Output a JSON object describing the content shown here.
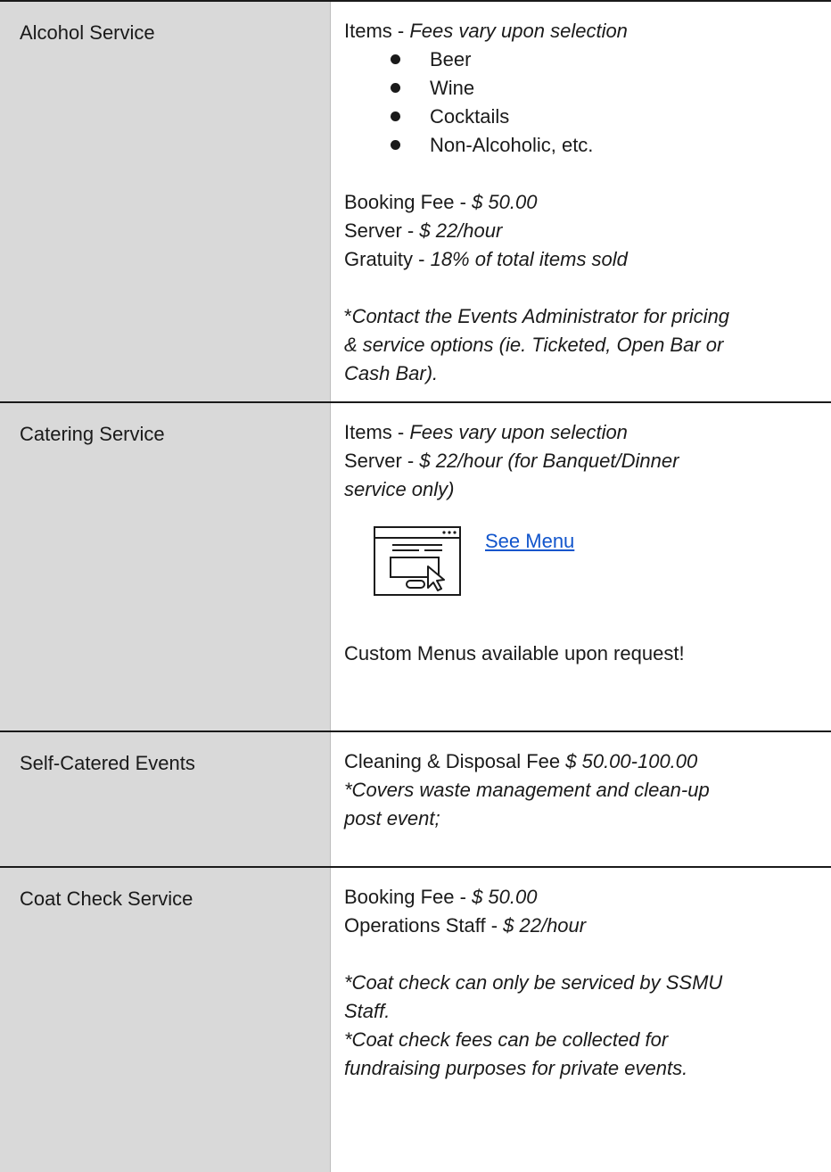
{
  "rows": [
    {
      "label": "Alcohol Service",
      "items_label": "Items - ",
      "items_value": "Fees vary upon selection",
      "bullets": [
        "Beer",
        "Wine",
        "Cocktails",
        "Non-Alcoholic, etc."
      ],
      "fees": [
        {
          "label": "Booking Fee - ",
          "value": "$ 50.00"
        },
        {
          "label": "Server - ",
          "value": "$ 22/hour"
        },
        {
          "label": "Gratuity - ",
          "value": "18% of total items sold"
        }
      ],
      "note_prefix": "*",
      "note_lines": [
        "Contact the Events Administrator for pricing",
        "& service options (ie. Ticketed, Open Bar or",
        "Cash Bar)."
      ]
    },
    {
      "label": "Catering Service",
      "items_label": "Items - ",
      "items_value": "Fees vary upon selection",
      "server_label": "Server - ",
      "server_value_line1": "$ 22/hour (for Banquet/Dinner",
      "server_value_line2": "service only)",
      "menu_link": "See Menu",
      "menu_icon": "web-page-click-icon",
      "custom_menus": "Custom Menus available upon request!"
    },
    {
      "label": "Self-Catered Events",
      "fee_label": "Cleaning & Disposal Fee ",
      "fee_value": "$ 50.00-100.00",
      "note_lines": [
        "*Covers waste management and clean-up",
        "post event;"
      ]
    },
    {
      "label": "Coat Check Service",
      "fees": [
        {
          "label": "Booking Fee - ",
          "value": "$ 50.00"
        },
        {
          "label": "Operations Staff  - ",
          "value": "$ 22/hour"
        }
      ],
      "note1_lines": [
        "*Coat check can only be serviced by SSMU",
        "Staff."
      ],
      "note2_lines": [
        "*Coat check fees can be collected for",
        "fundraising purposes for private events."
      ]
    }
  ]
}
